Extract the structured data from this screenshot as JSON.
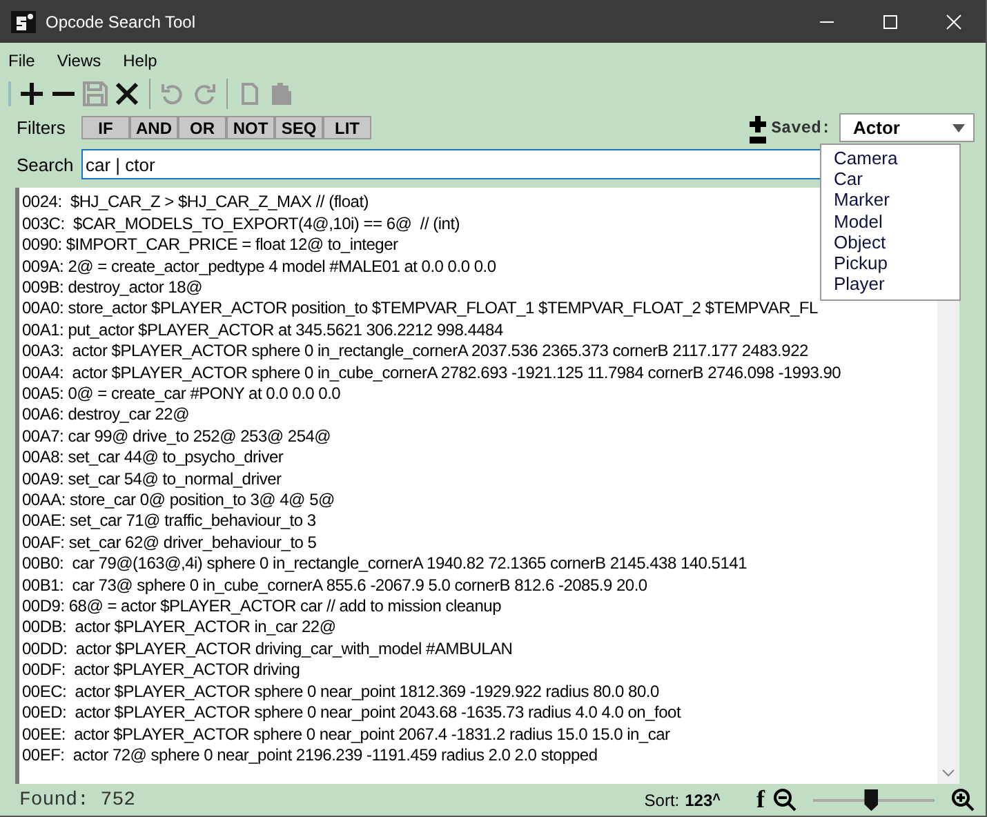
{
  "window": {
    "title": "Opcode Search Tool"
  },
  "menu": [
    "File",
    "Views",
    "Help"
  ],
  "toolbar": [
    {
      "kind": "add",
      "disabled": false
    },
    {
      "kind": "remove",
      "disabled": false
    },
    {
      "kind": "save",
      "disabled": true
    },
    {
      "kind": "delete",
      "disabled": false
    },
    {
      "kind": "undo",
      "disabled": true
    },
    {
      "kind": "redo",
      "disabled": true
    },
    {
      "kind": "copy",
      "disabled": true
    },
    {
      "kind": "paste",
      "disabled": true
    }
  ],
  "filters": {
    "label": "Filters",
    "buttons": [
      "IF",
      "AND",
      "OR",
      "NOT",
      "SEQ",
      "LIT"
    ]
  },
  "saved": {
    "label": "Saved:",
    "value": "Actor",
    "options": [
      "Camera",
      "Car",
      "Marker",
      "Model",
      "Object",
      "Pickup",
      "Player"
    ]
  },
  "search": {
    "label": "Search",
    "value": "car | ctor"
  },
  "results": [
    "0024:  $HJ_CAR_Z > $HJ_CAR_Z_MAX // (float)",
    "003C:  $CAR_MODELS_TO_EXPORT(4@,10i) == 6@  // (int)",
    "0090: $IMPORT_CAR_PRICE = float 12@ to_integer",
    "009A: 2@ = create_actor_pedtype 4 model #MALE01 at 0.0 0.0 0.0",
    "009B: destroy_actor 18@",
    "00A0: store_actor $PLAYER_ACTOR position_to $TEMPVAR_FLOAT_1 $TEMPVAR_FLOAT_2 $TEMPVAR_FL",
    "00A1: put_actor $PLAYER_ACTOR at 345.5621 306.2212 998.4484",
    "00A3:  actor $PLAYER_ACTOR sphere 0 in_rectangle_cornerA 2037.536 2365.373 cornerB 2117.177 2483.922",
    "00A4:  actor $PLAYER_ACTOR sphere 0 in_cube_cornerA 2782.693 -1921.125 11.7984 cornerB 2746.098 -1993.90",
    "00A5: 0@ = create_car #PONY at 0.0 0.0 0.0",
    "00A6: destroy_car 22@",
    "00A7: car 99@ drive_to 252@ 253@ 254@",
    "00A8: set_car 44@ to_psycho_driver",
    "00A9: set_car 54@ to_normal_driver",
    "00AA: store_car 0@ position_to 3@ 4@ 5@",
    "00AE: set_car 71@ traffic_behaviour_to 3",
    "00AF: set_car 62@ driver_behaviour_to 5",
    "00B0:  car 79@(163@,4i) sphere 0 in_rectangle_cornerA 1940.82 72.1365 cornerB 2145.438 140.5141",
    "00B1:  car 73@ sphere 0 in_cube_cornerA 855.6 -2067.9 5.0 cornerB 812.6 -2085.9 20.0",
    "00D9: 68@ = actor $PLAYER_ACTOR car // add to mission cleanup",
    "00DB:  actor $PLAYER_ACTOR in_car 22@",
    "00DD:  actor $PLAYER_ACTOR driving_car_with_model #AMBULAN",
    "00DF:  actor $PLAYER_ACTOR driving",
    "00EC:  actor $PLAYER_ACTOR sphere 0 near_point 1812.369 -1929.922 radius 80.0 80.0",
    "00ED:  actor $PLAYER_ACTOR sphere 0 near_point 2043.68 -1635.73 radius 4.0 4.0 on_foot",
    "00EE:  actor $PLAYER_ACTOR sphere 0 near_point 2067.4 -1831.2 radius 15.0 15.0 in_car",
    "00EF:  actor 72@ sphere 0 near_point 2196.239 -1191.459 radius 2.0 2.0 stopped"
  ],
  "status": {
    "found": "Found:  752",
    "sort_label": "Sort:",
    "sort_value": "123",
    "sort_caret": "˄",
    "font_glyph": "f",
    "zoom": {
      "level": 0.48
    }
  }
}
